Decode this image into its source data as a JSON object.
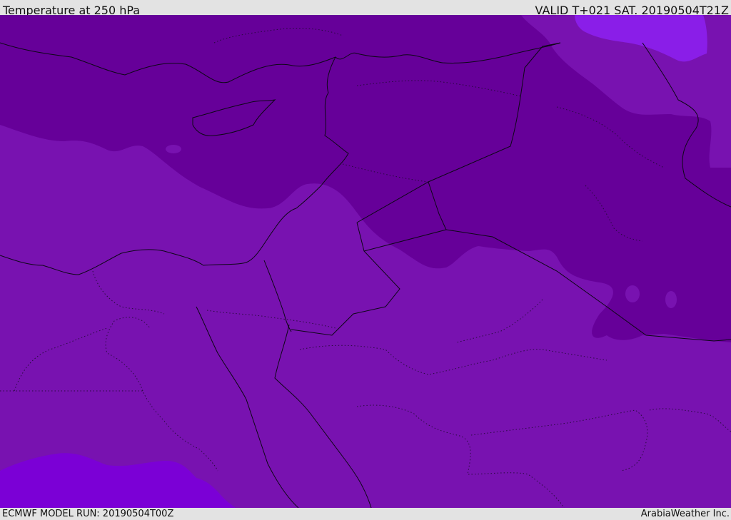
{
  "header": {
    "title": "Temperature at 250 hPa",
    "valid": "VALID T+021 SAT. 20190504T21Z"
  },
  "footer": {
    "model_run": "ECMWF MODEL RUN: 20190504T00Z",
    "credit": "ArabiaWeather Inc."
  },
  "colors": {
    "frame": "#e3e3e3",
    "band_cold": "#660099",
    "band_cool": "#7812b0",
    "band_mild": "#7b00d6",
    "band_bright": "#8a1ee8",
    "border": "#0d0716"
  }
}
